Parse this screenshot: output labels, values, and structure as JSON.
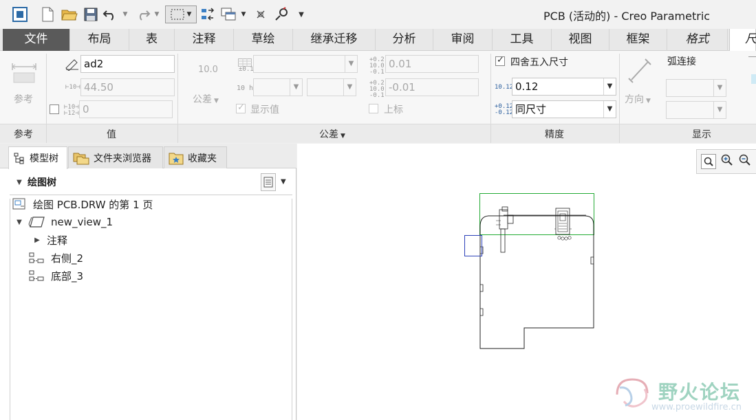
{
  "window": {
    "title": "PCB (活动的) - Creo Parametric"
  },
  "tabs": [
    {
      "label": "文件"
    },
    {
      "label": "布局"
    },
    {
      "label": "表"
    },
    {
      "label": "注释"
    },
    {
      "label": "草绘"
    },
    {
      "label": "继承迁移"
    },
    {
      "label": "分析"
    },
    {
      "label": "审阅"
    },
    {
      "label": "工具"
    },
    {
      "label": "视图"
    },
    {
      "label": "框架"
    },
    {
      "label": "格式"
    },
    {
      "label": "尺"
    }
  ],
  "ribbon": {
    "reference": {
      "label": "参考",
      "group_label": "参考"
    },
    "value": {
      "name_value": "ad2",
      "nominal_value": "44.50",
      "override_value": "0",
      "group_label": "值"
    },
    "tolerance": {
      "label": "公差",
      "show_value_label": "显示值",
      "upper_tol": "0.01",
      "lower_tol": "-0.01",
      "superscript_label": "上标",
      "group_label": "公差",
      "icon_10_0": "10.0",
      "icon_10h7": "10 h7",
      "icon_tol_upper": "+0.2 10.0 -0.1",
      "icon_tol_lower": "+0.2 10.0 -0.1",
      "icon_table": "±0.1",
      "icon_nominal": "⊢10⊣",
      "icon_override": "⊢10⊣ ⊢12⊣"
    },
    "precision": {
      "round_label": "四舍五入尺寸",
      "decimal_value": "0.12",
      "tol_precision_value": "同尺寸",
      "group_label": "精度",
      "icon_decimal": "10.123",
      "icon_tol_precision": "+0.123 -0.123"
    },
    "display": {
      "direction_label": "方向",
      "arc_connect_label": "弧连接",
      "group_label": "显示"
    }
  },
  "left_panel": {
    "tabs": [
      {
        "label": "模型树"
      },
      {
        "label": "文件夹浏览器"
      },
      {
        "label": "收藏夹"
      }
    ],
    "tree_title": "绘图树",
    "items": [
      {
        "label": "绘图 PCB.DRW 的第 1 页"
      },
      {
        "label": "new_view_1"
      },
      {
        "label": "注释"
      },
      {
        "label": "右侧_2"
      },
      {
        "label": "底部_3"
      }
    ]
  },
  "watermark": {
    "cn": "野火论坛",
    "en": "www.proewildfire.cn"
  }
}
